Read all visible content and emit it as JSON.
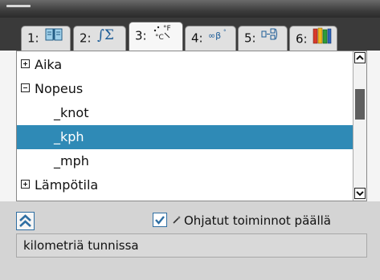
{
  "tabs": [
    {
      "number": "1:",
      "icon": "catalog-book-icon",
      "active": false
    },
    {
      "number": "2:",
      "icon": "math-integral-sum-icon",
      "active": false
    },
    {
      "number": "3:",
      "icon": "units-conversion-icon",
      "active": true
    },
    {
      "number": "4:",
      "icon": "symbols-infinity-beta-icon",
      "active": false
    },
    {
      "number": "5:",
      "icon": "templates-icon",
      "active": false
    },
    {
      "number": "6:",
      "icon": "libraries-icon",
      "active": false
    }
  ],
  "tree": {
    "items": [
      {
        "label": "Aika",
        "type": "category",
        "expanded": false
      },
      {
        "label": "Nopeus",
        "type": "category",
        "expanded": true
      },
      {
        "label": "_knot",
        "type": "unit"
      },
      {
        "label": "_kph",
        "type": "unit",
        "selected": true
      },
      {
        "label": "_mph",
        "type": "unit"
      },
      {
        "label": "Lämpötila",
        "type": "category",
        "expanded": false
      }
    ],
    "scroll_position": 0.3
  },
  "guided": {
    "checked": true,
    "label": "Ohjatut toiminnot päällä"
  },
  "description": "kilometriä tunnissa",
  "colors": {
    "selection": "#2f8ab6",
    "accent": "#2f6fa3",
    "tab_bar": "#3a3a3a",
    "scroll_thumb": "#5f5f5f"
  }
}
